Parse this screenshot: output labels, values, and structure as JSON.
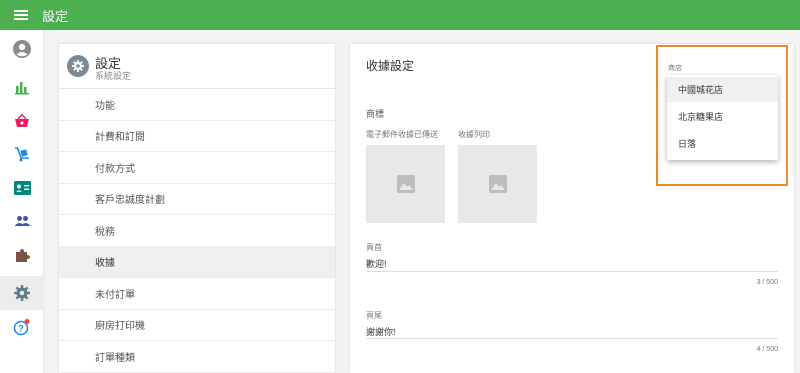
{
  "app": {
    "title": "設定"
  },
  "colors": {
    "topbar": "#4caf50",
    "highlight": "#e8892e",
    "notification_dot": "#f44336"
  },
  "rail": {
    "items": [
      {
        "icon": "account-circle-icon"
      },
      {
        "icon": "bar-chart-icon"
      },
      {
        "icon": "basket-icon"
      },
      {
        "icon": "delivery-cart-icon"
      },
      {
        "icon": "contact-card-icon"
      },
      {
        "icon": "people-icon"
      },
      {
        "icon": "puzzle-icon"
      },
      {
        "icon": "gear-icon",
        "active": true
      },
      {
        "icon": "help-icon",
        "badge": true
      }
    ]
  },
  "settings_panel": {
    "title": "設定",
    "subtitle": "系統設定",
    "menu": [
      {
        "label": "功能"
      },
      {
        "label": "計費和訂閱"
      },
      {
        "label": "付款方式"
      },
      {
        "label": "客戶忠誠度計劃"
      },
      {
        "label": "稅務"
      },
      {
        "label": "收據",
        "selected": true
      },
      {
        "label": "未付訂單"
      },
      {
        "label": "廚房打印機"
      },
      {
        "label": "訂單種類"
      }
    ]
  },
  "receipt": {
    "title": "收據設定",
    "logo_label": "商標",
    "email_receipt_label": "電子郵件收據已傳送",
    "print_receipt_label": "收據列印",
    "header": {
      "label": "頁首",
      "value": "歡迎!",
      "counter": "3 / 500"
    },
    "footer": {
      "label": "頁尾",
      "value": "謝謝你!",
      "counter": "4 / 500"
    },
    "store": {
      "label": "商店",
      "options": [
        {
          "label": "中國城花店",
          "highlighted": true
        },
        {
          "label": "北京糖果店"
        },
        {
          "label": "日落"
        }
      ]
    }
  }
}
